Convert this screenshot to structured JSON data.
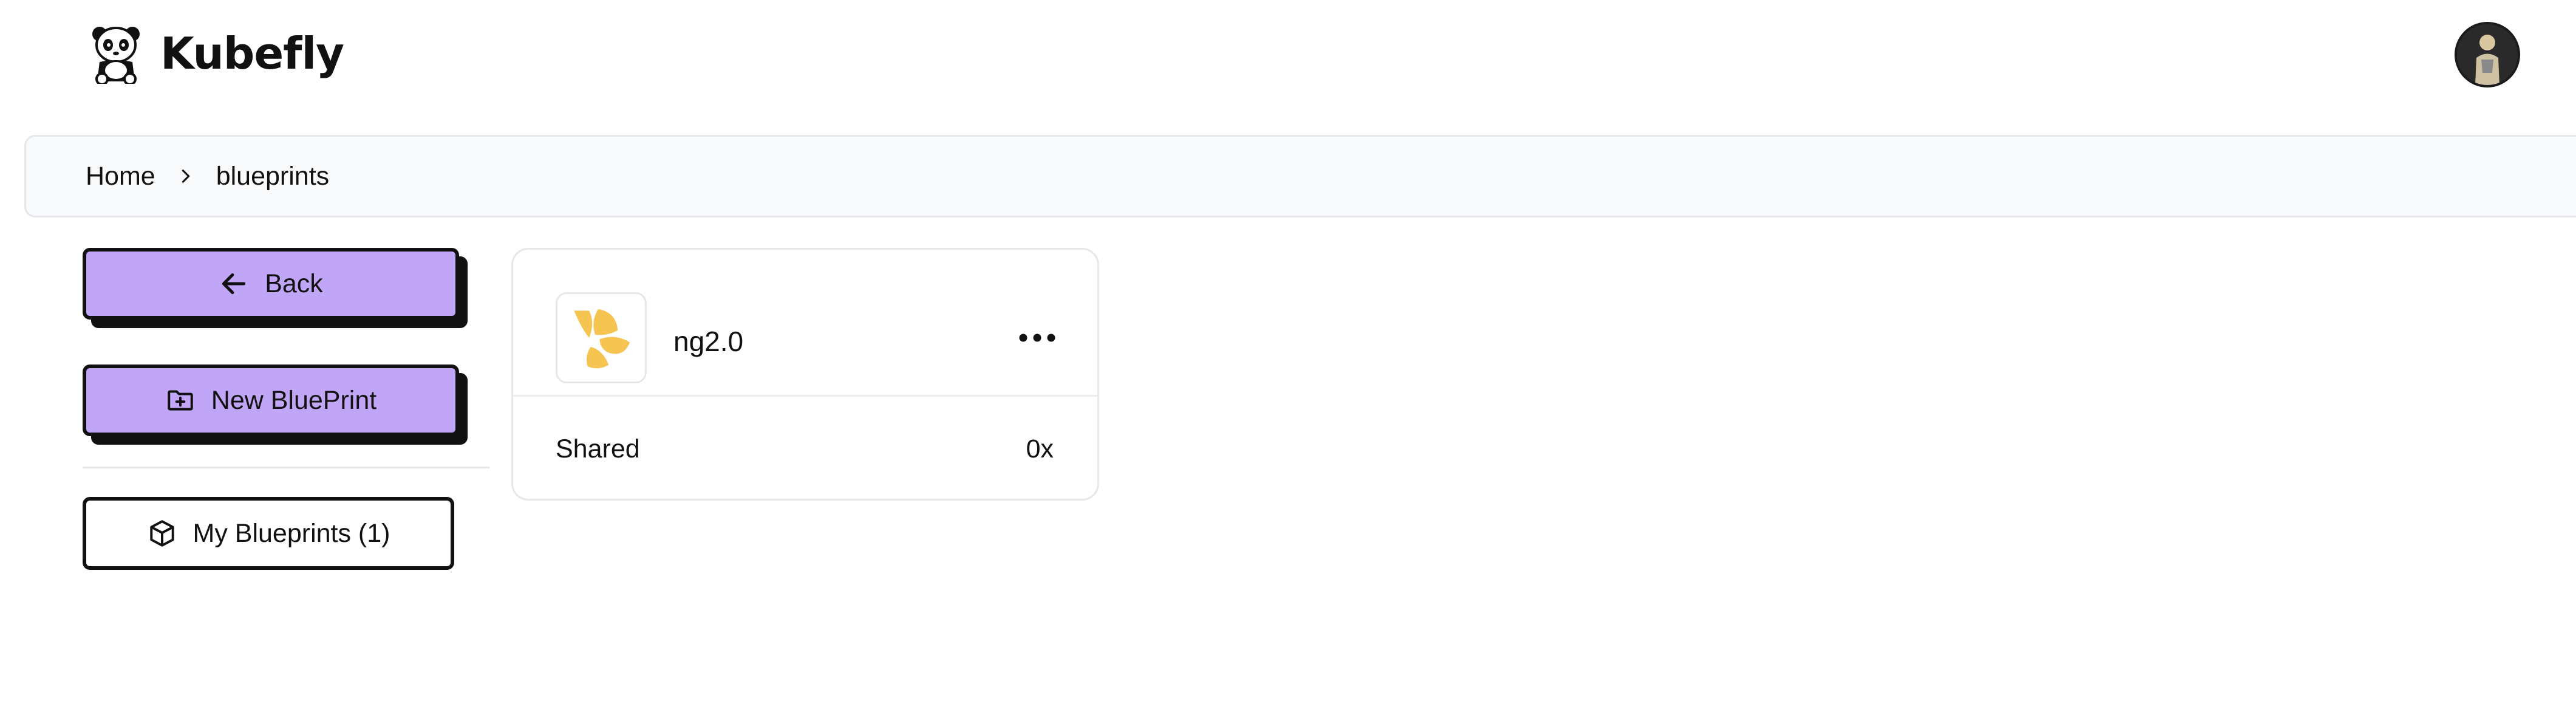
{
  "header": {
    "app_name": "Kubefly",
    "logo_icon": "panda-logo-icon",
    "avatar_icon": "user-avatar"
  },
  "breadcrumb": {
    "items": [
      "Home",
      "blueprints"
    ],
    "separator_icon": "chevron-right-icon"
  },
  "sidebar": {
    "back_label": "Back",
    "back_icon": "arrow-left-icon",
    "new_label": "New BluePrint",
    "new_icon": "folder-plus-icon",
    "my_blueprints_label": "My Blueprints (1)",
    "my_blueprints_icon": "cube-icon"
  },
  "blueprint_card": {
    "name": "ng2.0",
    "icon": "petal-logo-icon",
    "menu_icon": "more-horizontal-icon",
    "label": "Shared",
    "value": "0x"
  },
  "colors": {
    "primary_button": "#c1a6f7",
    "button_border": "#111111",
    "breadcrumb_bg": "#f9fafb",
    "petal_yellow": "#f5c451"
  }
}
